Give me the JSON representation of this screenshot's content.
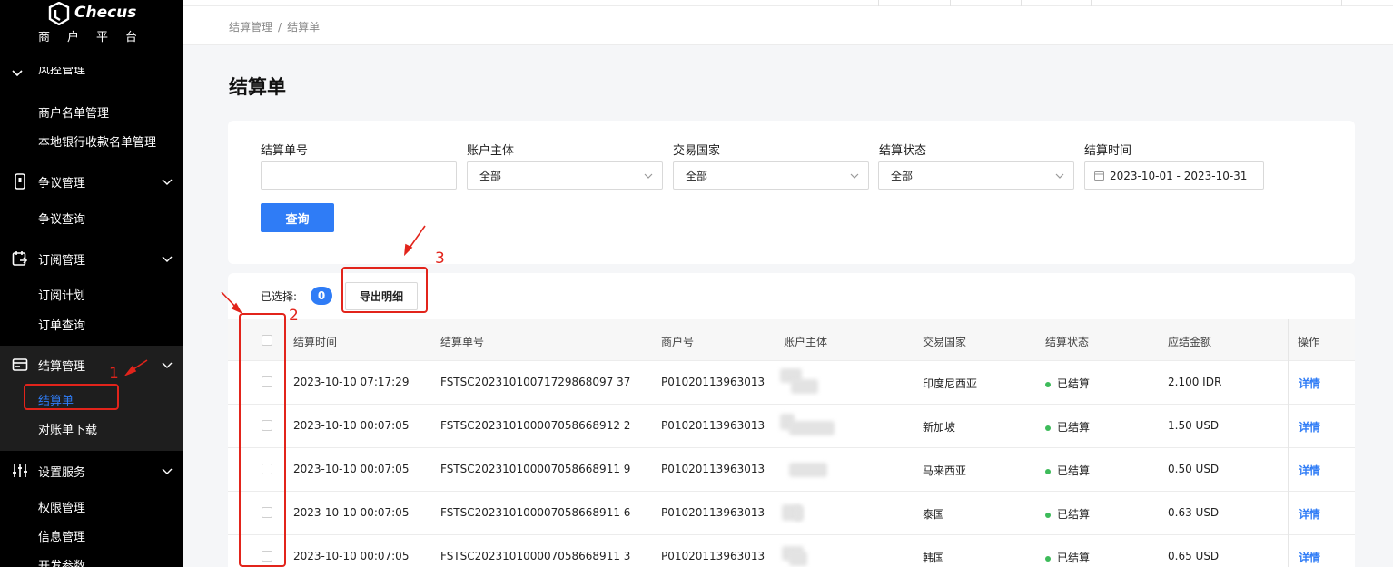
{
  "brand": {
    "name": "Checus",
    "subtitle": "商户平台"
  },
  "sidebar": {
    "partial_top_label": "风控管理",
    "groups": [
      {
        "label": "争议管理",
        "icon": "phone-icon"
      },
      {
        "label": "订阅管理",
        "icon": "calendar-icon"
      },
      {
        "label": "结算管理",
        "icon": "wallet-icon"
      },
      {
        "label": "设置服务",
        "icon": "sliders-icon"
      }
    ],
    "items": {
      "merchant_list": "商户名单管理",
      "local_bank_list": "本地银行收款名单管理",
      "dispute_query": "争议查询",
      "subscription_plan": "订阅计划",
      "order_query": "订单查询",
      "settlement_bill": "结算单",
      "statement_download": "对账单下载",
      "permission_mgmt": "权限管理",
      "info_mgmt": "信息管理",
      "dev_params": "开发参数"
    }
  },
  "breadcrumb": {
    "parent": "结算管理",
    "separator": "/",
    "current": "结算单"
  },
  "page_title": "结算单",
  "filters": {
    "bill_no_label": "结算单号",
    "bill_no_value": "",
    "account_label": "账户主体",
    "account_value": "全部",
    "country_label": "交易国家",
    "country_value": "全部",
    "status_label": "结算状态",
    "status_value": "全部",
    "time_label": "结算时间",
    "time_value": "2023-10-01 - 2023-10-31",
    "query_button": "查询"
  },
  "selection": {
    "label": "已选择:",
    "count": "0",
    "export_button": "导出明细"
  },
  "table": {
    "headers": {
      "time": "结算时间",
      "bill_no": "结算单号",
      "merchant_no": "商户号",
      "account": "账户主体",
      "country": "交易国家",
      "status": "结算状态",
      "amount": "应结金额",
      "action": "操作"
    },
    "rows": [
      {
        "time": "2023-10-10 07:17:29",
        "bill_no": "FSTSC20231010071729868097 37",
        "merchant_no": "P01020113963013",
        "country": "印度尼西亚",
        "status": "已结算",
        "amount": "2.100 IDR",
        "action": "详情"
      },
      {
        "time": "2023-10-10 00:07:05",
        "bill_no": "FSTSC202310100007058668912 2",
        "merchant_no": "P01020113963013",
        "country": "新加坡",
        "status": "已结算",
        "amount": "1.50 USD",
        "action": "详情"
      },
      {
        "time": "2023-10-10 00:07:05",
        "bill_no": "FSTSC202310100007058668911 9",
        "merchant_no": "P01020113963013",
        "country": "马来西亚",
        "status": "已结算",
        "amount": "0.50 USD",
        "action": "详情"
      },
      {
        "time": "2023-10-10 00:07:05",
        "bill_no": "FSTSC202310100007058668911 6",
        "merchant_no": "P01020113963013",
        "country": "泰国",
        "status": "已结算",
        "amount": "0.63 USD",
        "action": "详情"
      },
      {
        "time": "2023-10-10 00:07:05",
        "bill_no": "FSTSC202310100007058668911 3",
        "merchant_no": "P01020113963013",
        "country": "韩国",
        "status": "已结算",
        "amount": "0.65 USD",
        "action": "详情"
      }
    ]
  },
  "annotations": {
    "one": "1",
    "two": "2",
    "three": "3"
  },
  "colors": {
    "accent": "#2f7cf6",
    "annotation": "#e2241b",
    "status_ok": "#3dbb5a",
    "sidebar_bg": "#000000"
  }
}
